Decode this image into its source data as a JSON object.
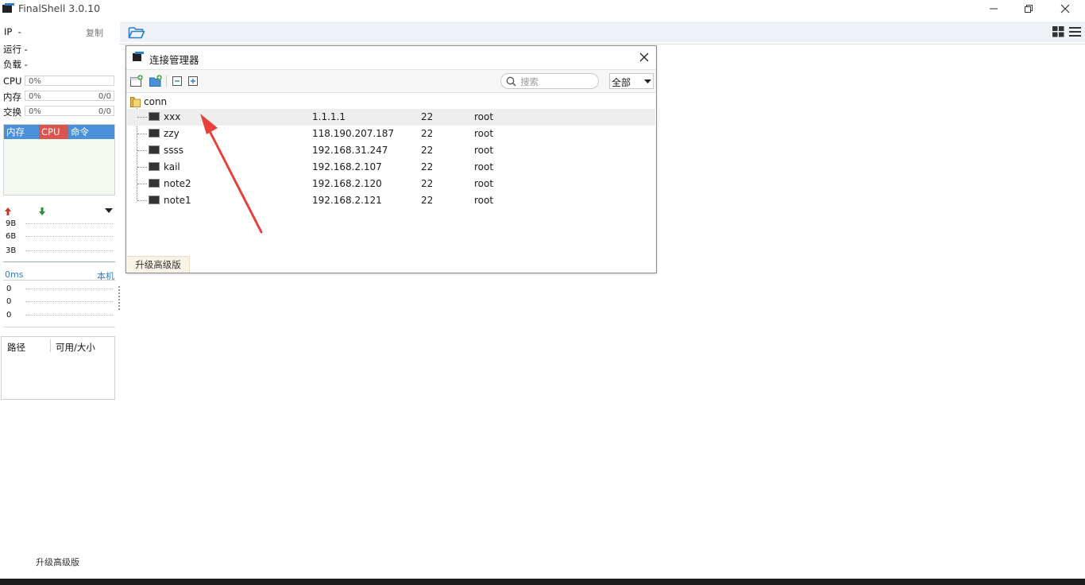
{
  "window": {
    "title": "FinalShell 3.0.10"
  },
  "left_panel": {
    "ip_label": "IP",
    "ip_value": "-",
    "copy_label": "复制",
    "run_label": "运行 -",
    "load_label": "负载 -",
    "cpu_label": "CPU",
    "cpu_value": "0%",
    "mem_label": "内存",
    "mem_value": "0%",
    "mem_ratio": "0/0",
    "swap_label": "交换",
    "swap_value": "0%",
    "swap_ratio": "0/0",
    "tabs": [
      {
        "label": "内存",
        "color": "#4a90d9"
      },
      {
        "label": "CPU",
        "color": "#d9534f"
      },
      {
        "label": "命令",
        "color": "#4a90d9"
      }
    ],
    "net_ticks": [
      "9B",
      "6B",
      "3B"
    ],
    "latency_label": "0ms",
    "local_label": "本机",
    "latency_ticks": [
      "0",
      "0",
      "0"
    ],
    "disk_headers": [
      "路径",
      "可用/大小"
    ],
    "upgrade_label": "升级高级版"
  },
  "dialog": {
    "title": "连接管理器",
    "search_placeholder": "搜索",
    "filter_value": "全部",
    "folder_name": "conn",
    "connections": [
      {
        "name": "xxx",
        "host": "1.1.1.1",
        "port": "22",
        "user": "root",
        "selected": true
      },
      {
        "name": "zzy",
        "host": "118.190.207.187",
        "port": "22",
        "user": "root"
      },
      {
        "name": "ssss",
        "host": "192.168.31.247",
        "port": "22",
        "user": "root"
      },
      {
        "name": "kail",
        "host": "192.168.2.107",
        "port": "22",
        "user": "root"
      },
      {
        "name": "note2",
        "host": "192.168.2.120",
        "port": "22",
        "user": "root"
      },
      {
        "name": "note1",
        "host": "192.168.2.121",
        "port": "22",
        "user": "root"
      }
    ],
    "upgrade_label": "升级高级版"
  },
  "colors": {
    "accent": "#2d7fd3",
    "annotation_arrow": "#e8403a",
    "green_add": "#3aa63a"
  }
}
